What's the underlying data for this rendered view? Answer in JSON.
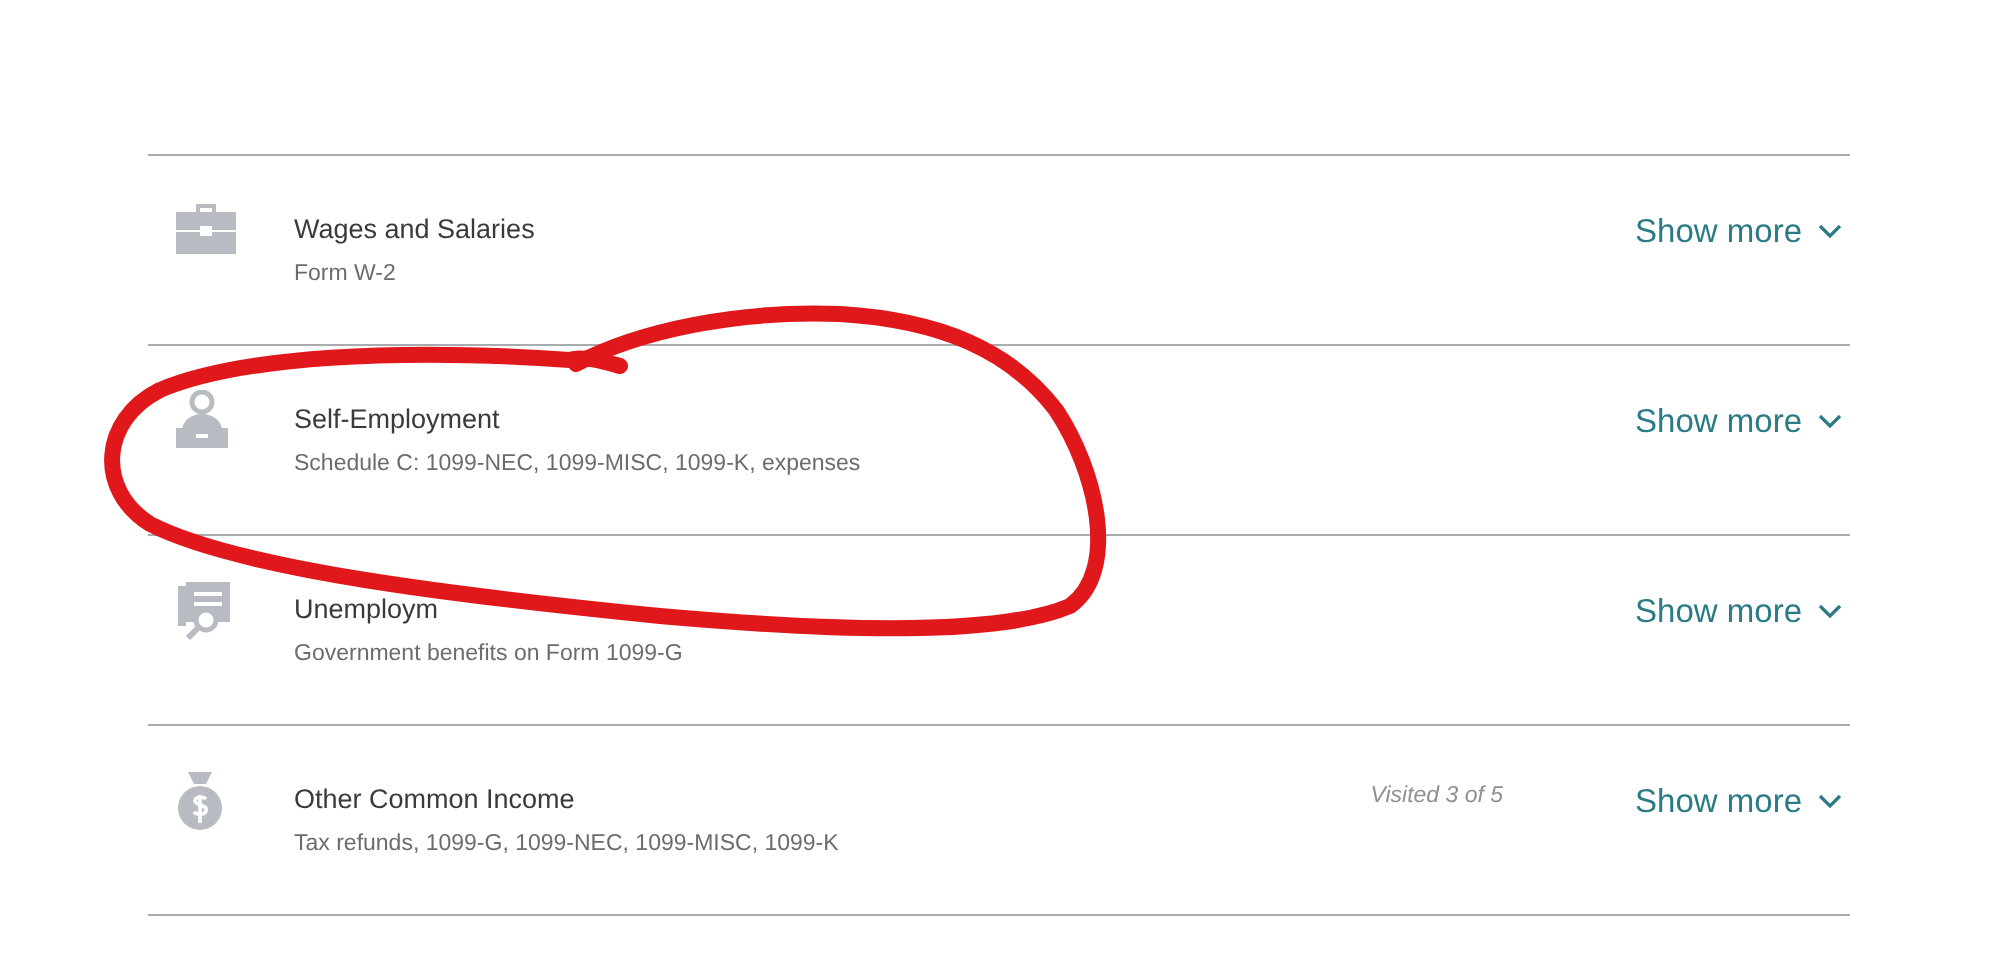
{
  "income_categories": [
    {
      "kind": "briefcase",
      "title": "Wages and Salaries",
      "subtitle": "Form W-2",
      "action": "Show more"
    },
    {
      "kind": "laptop-person",
      "title": "Self-Employment",
      "subtitle": "Schedule C: 1099-NEC, 1099-MISC, 1099-K, expenses",
      "action": "Show more"
    },
    {
      "kind": "document-search",
      "title": "Unemploym",
      "subtitle": "Government benefits on Form 1099-G",
      "action": "Show more"
    },
    {
      "kind": "money-bag",
      "title": "Other Common Income",
      "subtitle": "Tax refunds, 1099-G, 1099-NEC, 1099-MISC, 1099-K",
      "progress": "Visited 3 of 5",
      "action": "Show more"
    }
  ]
}
